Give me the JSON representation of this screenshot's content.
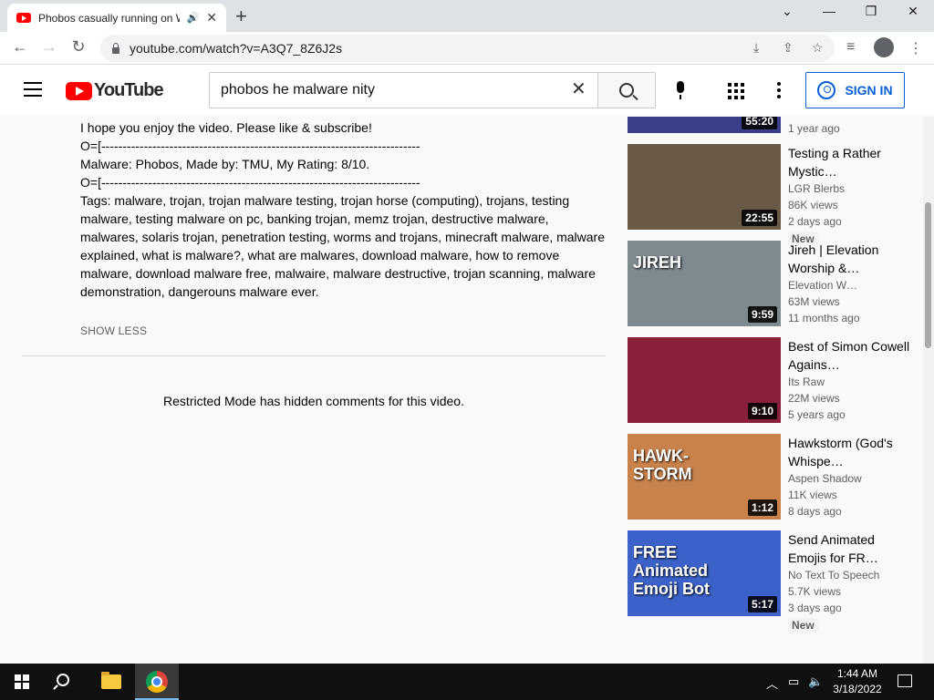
{
  "browser": {
    "tab_title": "Phobos casually running on W",
    "url": "youtube.com/watch?v=A3Q7_8Z6J2s"
  },
  "youtube": {
    "logo_text": "YouTube",
    "search_value": "phobos he malware nity",
    "sign_in_label": "SIGN IN"
  },
  "description": {
    "lines": [
      "I hope you enjoy the video. Please like & subscribe!",
      "O=[---------------------------------------------------------------------------",
      "Malware: Phobos, Made by: TMU, My Rating: 8/10.",
      "O=[---------------------------------------------------------------------------",
      "Tags: malware, trojan, trojan malware testing, trojan horse (computing), trojans, testing malware, testing malware on pc, banking trojan, memz trojan, destructive malware, malwares, solaris trojan, penetration testing, worms and trojans, minecraft malware, malware explained, what is malware?, what are malwares, download malware, how to remove malware, download malware free, malwaire, malware destructive, trojan scanning, malware demonstration, dangerouns malware ever."
    ],
    "show_less": "SHOW LESS"
  },
  "comments": {
    "restricted_notice": "Restricted Mode has hidden comments for this video."
  },
  "sidebar": {
    "partial_top": {
      "duration": "55:20",
      "age": "1 year ago"
    },
    "videos": [
      {
        "title": "Testing a Rather Mystic…",
        "channel": "LGR Blerbs",
        "views": "86K views",
        "age": "2 days ago",
        "duration": "22:55",
        "badge": "New",
        "thumb_color": "#6b5a48"
      },
      {
        "title": "Jireh | Elevation Worship &…",
        "channel": "Elevation W…",
        "views": "63M views",
        "age": "11 months ago",
        "duration": "9:59",
        "badge": "",
        "thumb_color": "#7f8a8f",
        "thumb_text": "JIREH"
      },
      {
        "title": "Best of Simon Cowell Agains…",
        "channel": "Its Raw",
        "views": "22M views",
        "age": "5 years ago",
        "duration": "9:10",
        "badge": "",
        "thumb_color": "#8a1f3c"
      },
      {
        "title": "Hawkstorm (God's Whispe…",
        "channel": "Aspen Shadow",
        "views": "11K views",
        "age": "8 days ago",
        "duration": "1:12",
        "badge": "",
        "thumb_color": "#c9824a",
        "thumb_text": "HAWK-\nSTORM"
      },
      {
        "title": "Send Animated Emojis for FR…",
        "channel": "No Text To Speech",
        "views": "5.7K views",
        "age": "3 days ago",
        "duration": "5:17",
        "badge": "New",
        "thumb_color": "#3c62c9",
        "thumb_text": "FREE\nAnimated\nEmoji Bot"
      }
    ]
  },
  "taskbar": {
    "time": "1:44 AM",
    "date": "3/18/2022"
  }
}
